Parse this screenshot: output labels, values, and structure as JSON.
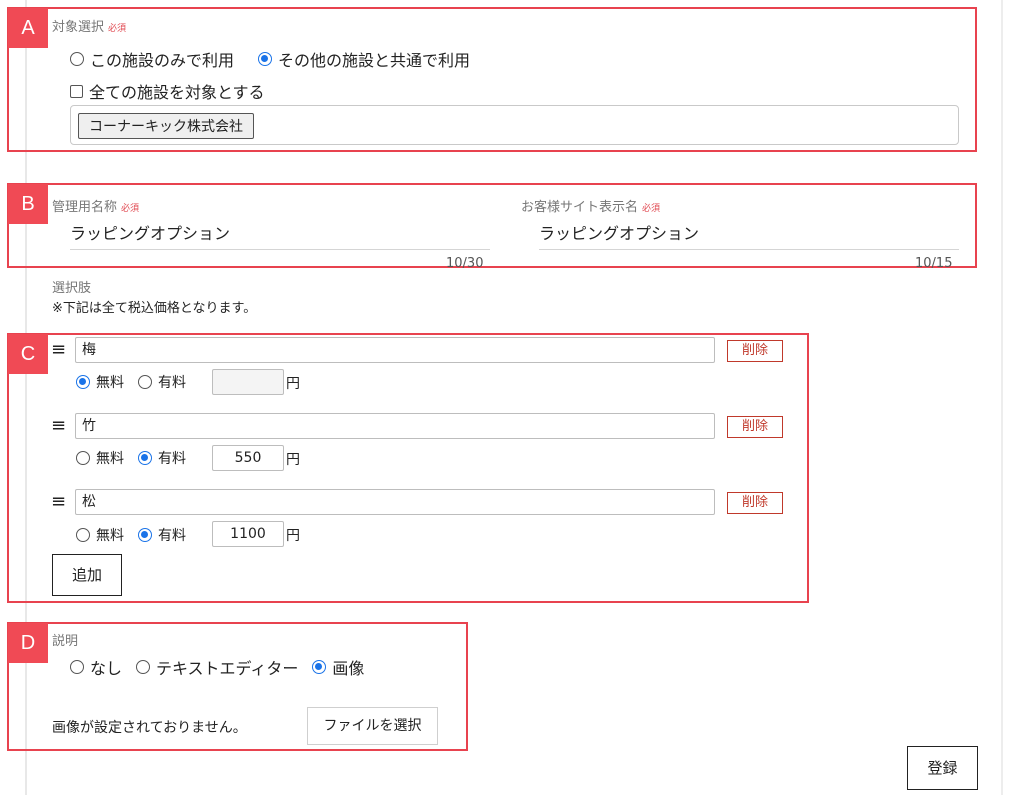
{
  "section_a": {
    "tag": "A",
    "label": "対象選択",
    "required": "必須",
    "option_only": "この施設のみで利用",
    "option_shared": "その他の施設と共通で利用",
    "all_facilities": "全ての施設を対象とする",
    "chip": "コーナーキック株式会社"
  },
  "section_b": {
    "tag": "B",
    "mgmt_label": "管理用名称",
    "mgmt_required": "必須",
    "mgmt_value": "ラッピングオプション",
    "mgmt_counter": "10/30",
    "site_label": "お客様サイト表示名",
    "site_required": "必須",
    "site_value": "ラッピングオプション",
    "site_counter": "10/15"
  },
  "choices_heading": {
    "label": "選択肢",
    "note": "※下記は全て税込価格となります。"
  },
  "section_c": {
    "tag": "C",
    "handle": "≡",
    "free_label": "無料",
    "paid_label": "有料",
    "yen": "円",
    "delete_label": "削除",
    "add_label": "追加",
    "items": [
      {
        "name": "梅",
        "price": ""
      },
      {
        "name": "竹",
        "price": "550"
      },
      {
        "name": "松",
        "price": "1100"
      }
    ]
  },
  "section_d": {
    "tag": "D",
    "label": "説明",
    "opt_none": "なし",
    "opt_editor": "テキストエディター",
    "opt_image": "画像",
    "no_image": "画像が設定されておりません。",
    "file_button": "ファイルを選択"
  },
  "submit": {
    "label": "登録"
  },
  "colors": {
    "accent": "#f04a55",
    "radio": "#1a73e8",
    "delete": "#c0392b"
  }
}
